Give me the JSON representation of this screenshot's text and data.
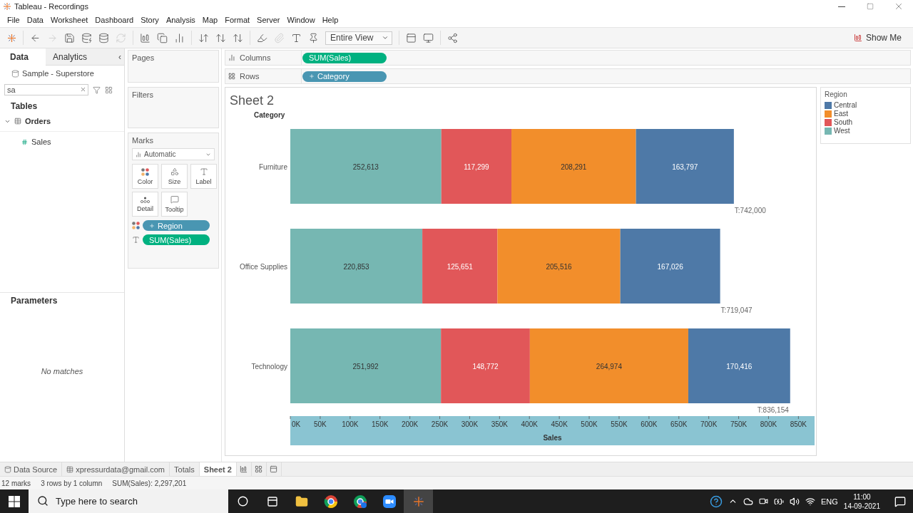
{
  "window": {
    "title": "Tableau - Recordings"
  },
  "menu": [
    "File",
    "Data",
    "Worksheet",
    "Dashboard",
    "Story",
    "Analysis",
    "Map",
    "Format",
    "Server",
    "Window",
    "Help"
  ],
  "toolbar": {
    "view_dropdown": "Entire View",
    "show_me": "Show Me"
  },
  "data_pane": {
    "tabs": [
      {
        "label": "Data",
        "selected": true
      },
      {
        "label": "Analytics",
        "selected": false
      }
    ],
    "collapse": "‹",
    "source": "Sample - Superstore",
    "search": {
      "value": "sa"
    },
    "tables_heading": "Tables",
    "tables": [
      {
        "label": "Orders",
        "expanded": true,
        "children": [
          {
            "label": "Sales"
          }
        ]
      }
    ],
    "parameters_heading": "Parameters",
    "parameters_empty": "No matches"
  },
  "cards": {
    "pages": "Pages",
    "filters": "Filters",
    "marks": {
      "title": "Marks",
      "mark_type": "Automatic",
      "buttons": [
        {
          "kind": "color",
          "label": "Color"
        },
        {
          "kind": "size",
          "label": "Size"
        },
        {
          "kind": "label",
          "label": "Label"
        },
        {
          "kind": "detail",
          "label": "Detail"
        },
        {
          "kind": "tooltip",
          "label": "Tooltip"
        }
      ],
      "fields": [
        {
          "kind": "color",
          "pill": {
            "text": "Region",
            "kind": "dimension"
          }
        },
        {
          "kind": "label",
          "pill": {
            "text": "SUM(Sales)",
            "kind": "measure"
          }
        }
      ]
    }
  },
  "shelves": [
    {
      "label": "Columns",
      "kind": "columns",
      "pills": [
        {
          "text": "SUM(Sales)",
          "kind": "measure"
        }
      ]
    },
    {
      "label": "Rows",
      "kind": "rows",
      "pills": [
        {
          "text": "Category",
          "kind": "dimension"
        }
      ]
    }
  ],
  "sheet": {
    "title": "Sheet 2",
    "row_header": "Category",
    "legend_title": "Region",
    "chart_data": {
      "type": "bar",
      "orientation": "horizontal",
      "stacked": true,
      "xlabel": "Sales",
      "categories": [
        "Furniture",
        "Office Supplies",
        "Technology"
      ],
      "series": [
        {
          "name": "West",
          "color": "#76b7b2",
          "values": [
            252613,
            220853,
            251992
          ],
          "value_labels": [
            "252,613",
            "220,853",
            "251,992"
          ]
        },
        {
          "name": "South",
          "color": "#e15759",
          "values": [
            117299,
            125651,
            148772
          ],
          "value_labels": [
            "117,299",
            "125,651",
            "148,772"
          ]
        },
        {
          "name": "East",
          "color": "#f28e2b",
          "values": [
            208291,
            205516,
            264974
          ],
          "value_labels": [
            "208,291",
            "205,516",
            "264,974"
          ]
        },
        {
          "name": "Central",
          "color": "#4e79a7",
          "values": [
            163797,
            167026,
            170416
          ],
          "value_labels": [
            "163,797",
            "167,026",
            "170,416"
          ]
        }
      ],
      "xlim": [
        0,
        877000
      ],
      "xticks": [
        {
          "value": 0,
          "label": "0K"
        },
        {
          "value": 50000,
          "label": "50K"
        },
        {
          "value": 100000,
          "label": "100K"
        },
        {
          "value": 150000,
          "label": "150K"
        },
        {
          "value": 200000,
          "label": "200K"
        },
        {
          "value": 250000,
          "label": "250K"
        },
        {
          "value": 300000,
          "label": "300K"
        },
        {
          "value": 350000,
          "label": "350K"
        },
        {
          "value": 400000,
          "label": "400K"
        },
        {
          "value": 450000,
          "label": "450K"
        },
        {
          "value": 500000,
          "label": "500K"
        },
        {
          "value": 550000,
          "label": "550K"
        },
        {
          "value": 600000,
          "label": "600K"
        },
        {
          "value": 650000,
          "label": "650K"
        },
        {
          "value": 700000,
          "label": "700K"
        },
        {
          "value": 750000,
          "label": "750K"
        },
        {
          "value": 800000,
          "label": "800K"
        },
        {
          "value": 850000,
          "label": "850K"
        }
      ],
      "annotations": [
        "T:742,000",
        "T:719,047",
        "T:836,154"
      ]
    }
  },
  "sheet_tabs": [
    {
      "label": "Data Source",
      "kind": "source",
      "selected": false
    },
    {
      "label": "xpressurdata@gmail.com",
      "kind": "sheet-table",
      "selected": false
    },
    {
      "label": "Totals",
      "kind": "sheet",
      "selected": false
    },
    {
      "label": "Sheet 2",
      "kind": "sheet",
      "selected": true
    }
  ],
  "status_bar": [
    "12 marks",
    "3 rows by 1 column",
    "SUM(Sales): 2,297,201"
  ],
  "taskbar": {
    "search": {
      "placeholder": "Type here to search"
    },
    "language": "ENG",
    "time": "11:00",
    "date": "14-09-2021"
  }
}
